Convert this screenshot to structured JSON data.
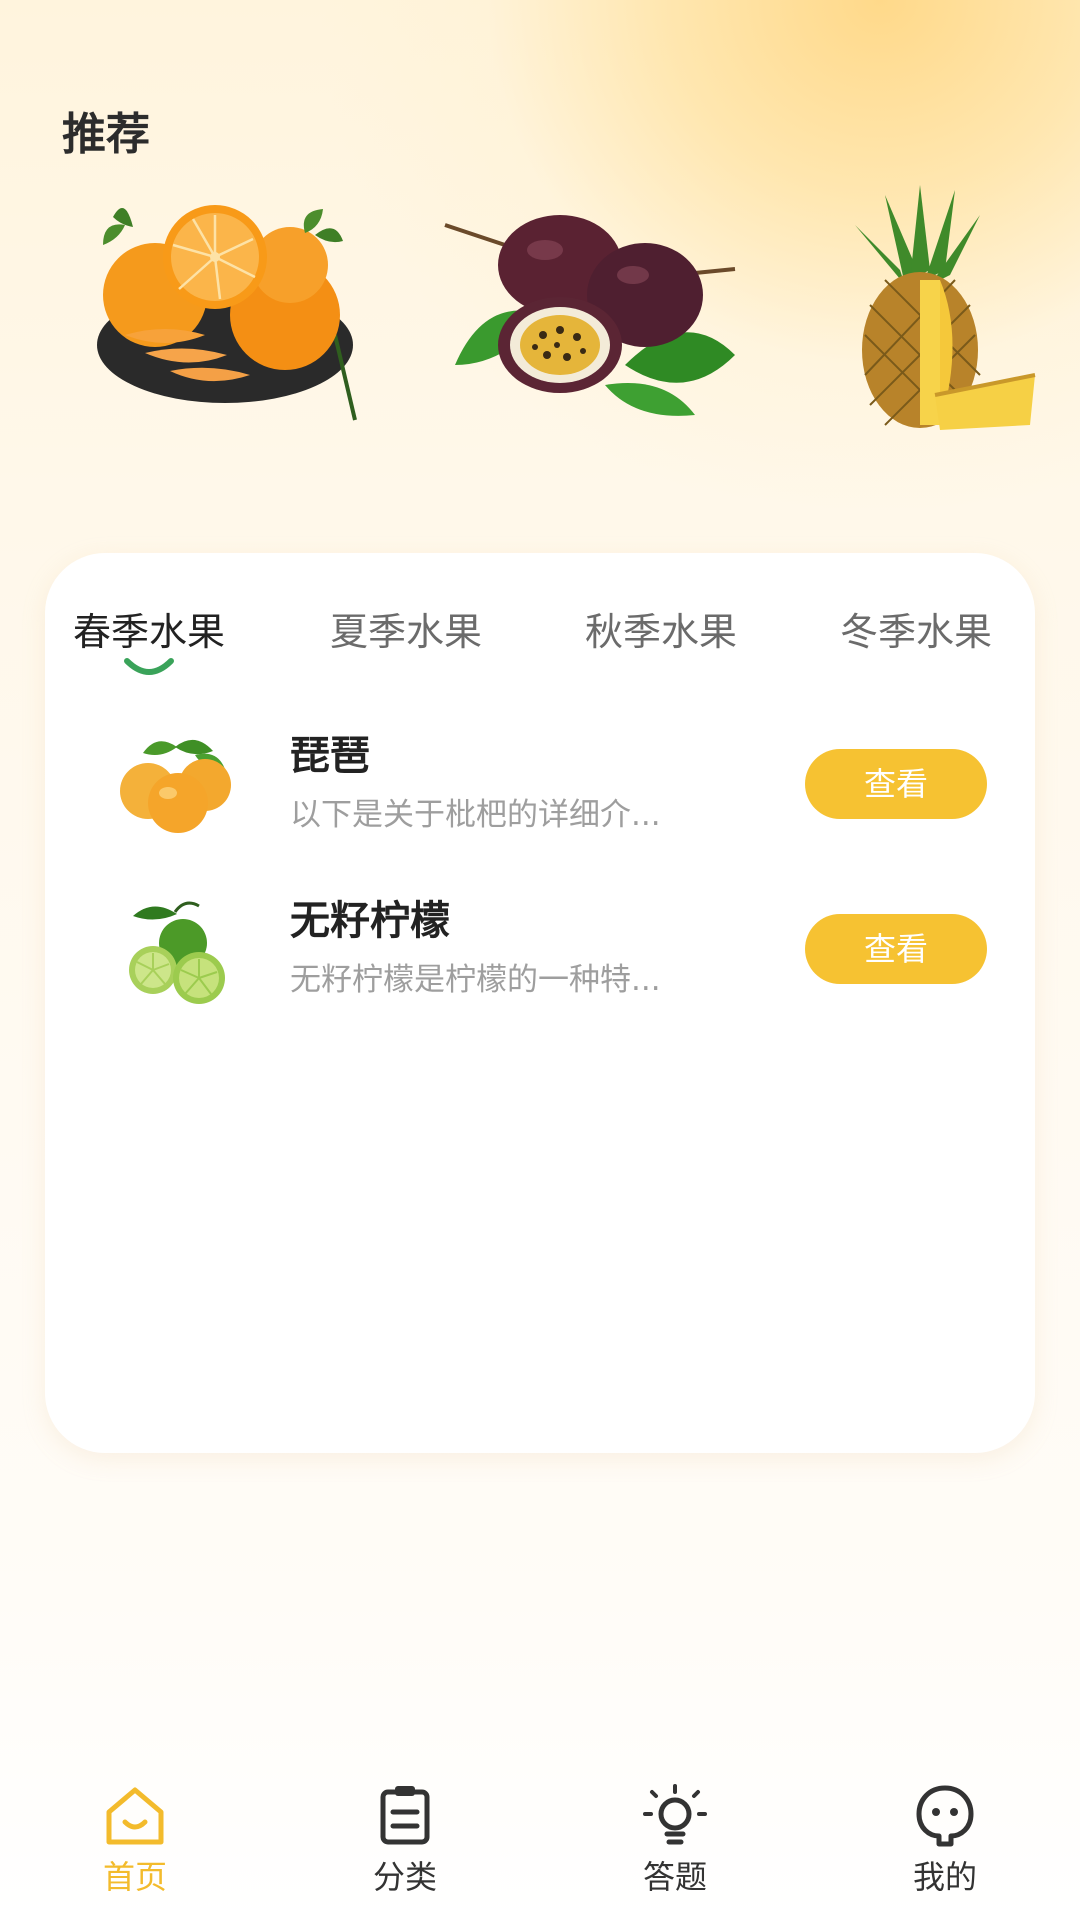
{
  "header": {
    "title": "推荐"
  },
  "recommendations": [
    {
      "name": "orange-plate-image"
    },
    {
      "name": "passion-fruit-image"
    },
    {
      "name": "pineapple-image"
    }
  ],
  "tabs": [
    {
      "label": "春季水果",
      "active": true
    },
    {
      "label": "夏季水果",
      "active": false
    },
    {
      "label": "秋季水果",
      "active": false
    },
    {
      "label": "冬季水果",
      "active": false
    }
  ],
  "fruits": [
    {
      "title": "琵琶",
      "desc": "以下是关于枇杷的详细介...",
      "button": "查看",
      "icon": "loquat-image"
    },
    {
      "title": "无籽柠檬",
      "desc": "无籽柠檬是柠檬的一种特...",
      "button": "查看",
      "icon": "lime-image"
    }
  ],
  "nav": [
    {
      "label": "首页",
      "icon": "home-icon",
      "active": true
    },
    {
      "label": "分类",
      "icon": "clipboard-icon",
      "active": false
    },
    {
      "label": "答题",
      "icon": "lightbulb-icon",
      "active": false
    },
    {
      "label": "我的",
      "icon": "profile-icon",
      "active": false
    }
  ],
  "colors": {
    "accent": "#f6c232",
    "tab_indicator": "#3aa35a",
    "active_nav": "#f3bb2c"
  }
}
